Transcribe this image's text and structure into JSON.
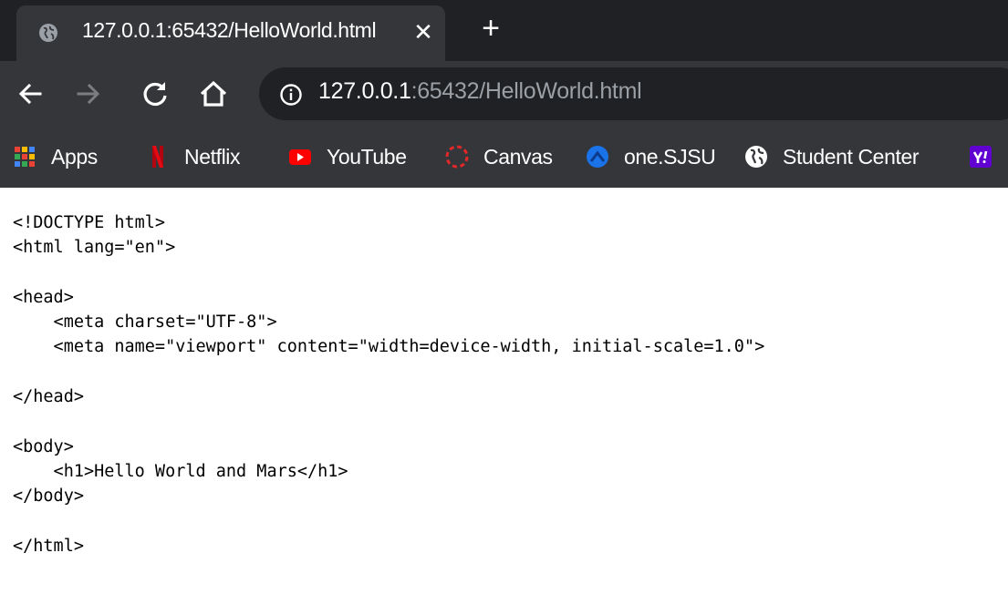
{
  "browser": {
    "tab": {
      "title": "127.0.0.1:65432/HelloWorld.html",
      "close_label": "✕"
    },
    "new_tab_label": "+",
    "omnibox": {
      "host": "127.0.0.1",
      "rest": ":65432/HelloWorld.html"
    },
    "bookmarks": [
      {
        "label": "Apps",
        "icon": "apps-grid-icon"
      },
      {
        "label": "Netflix",
        "icon": "netflix-icon"
      },
      {
        "label": "YouTube",
        "icon": "youtube-icon"
      },
      {
        "label": "Canvas",
        "icon": "canvas-icon"
      },
      {
        "label": "one.SJSU",
        "icon": "onesjsu-icon"
      },
      {
        "label": "Student Center",
        "icon": "globe-icon"
      },
      {
        "label": "",
        "icon": "yahoo-icon"
      }
    ]
  },
  "page": {
    "source": "<!DOCTYPE html>\n<html lang=\"en\">\n\n<head>\n    <meta charset=\"UTF-8\">\n    <meta name=\"viewport\" content=\"width=device-width, initial-scale=1.0\">\n\n</head>\n\n<body>\n    <h1>Hello World and Mars</h1>\n</body>\n\n</html>"
  },
  "colors": {
    "tabstrip": "#202124",
    "toolbar": "#35363a",
    "omnibox": "#202124",
    "netflix_red": "#e50914",
    "youtube_red": "#ff0000",
    "canvas_red": "#e4282a",
    "yahoo_purple": "#6001d2"
  }
}
